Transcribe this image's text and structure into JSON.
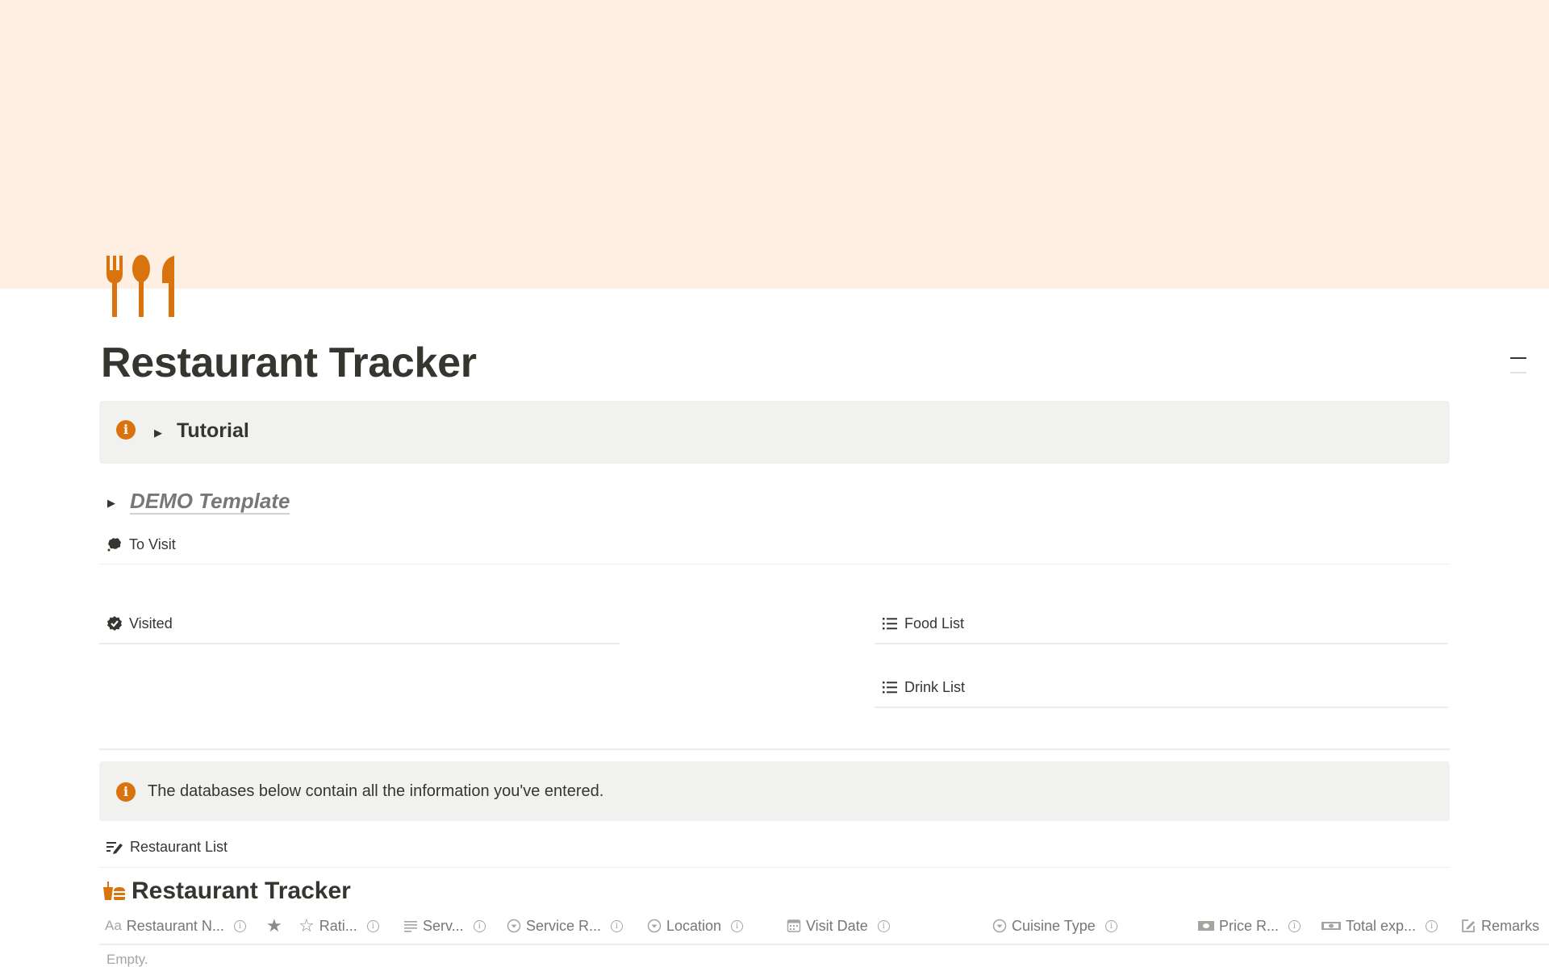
{
  "page": {
    "title": "Restaurant Tracker",
    "cover_color": "#feefe2",
    "icon": "fork-spoon-knife-icon",
    "accent_color": "#d9730d"
  },
  "tutorial_callout": {
    "icon": "info-icon",
    "toggle_label": "Tutorial"
  },
  "demo_toggle": {
    "label": "DEMO Template"
  },
  "links": {
    "to_visit": "To Visit",
    "visited": "Visited",
    "food_list": "Food List",
    "drink_list": "Drink List"
  },
  "db_callout": {
    "icon": "info-icon",
    "text": "The databases below contain all the information you've entered."
  },
  "restaurant_list": {
    "label": "Restaurant List"
  },
  "database": {
    "title": "Restaurant Tracker",
    "columns": [
      {
        "icon": "text-aa-icon",
        "label": "Restaurant N...",
        "info": true
      },
      {
        "icon": "star-filled-icon",
        "label": "",
        "info": false
      },
      {
        "icon": "star-outline-icon",
        "label": "Rati...",
        "info": true
      },
      {
        "icon": "lines-icon",
        "label": "Serv...",
        "info": true
      },
      {
        "icon": "select-icon",
        "label": "Service R...",
        "info": true
      },
      {
        "icon": "select-icon",
        "label": "Location",
        "info": true
      },
      {
        "icon": "calendar-icon",
        "label": "Visit Date",
        "info": true
      },
      {
        "icon": "select-icon",
        "label": "Cuisine Type",
        "info": true
      },
      {
        "icon": "money-icon",
        "label": "Price R...",
        "info": true
      },
      {
        "icon": "money-stack-icon",
        "label": "Total exp...",
        "info": true
      },
      {
        "icon": "edit-icon",
        "label": "Remarks",
        "info": false
      }
    ],
    "info_glyph": "i",
    "empty_label": "Empty."
  }
}
